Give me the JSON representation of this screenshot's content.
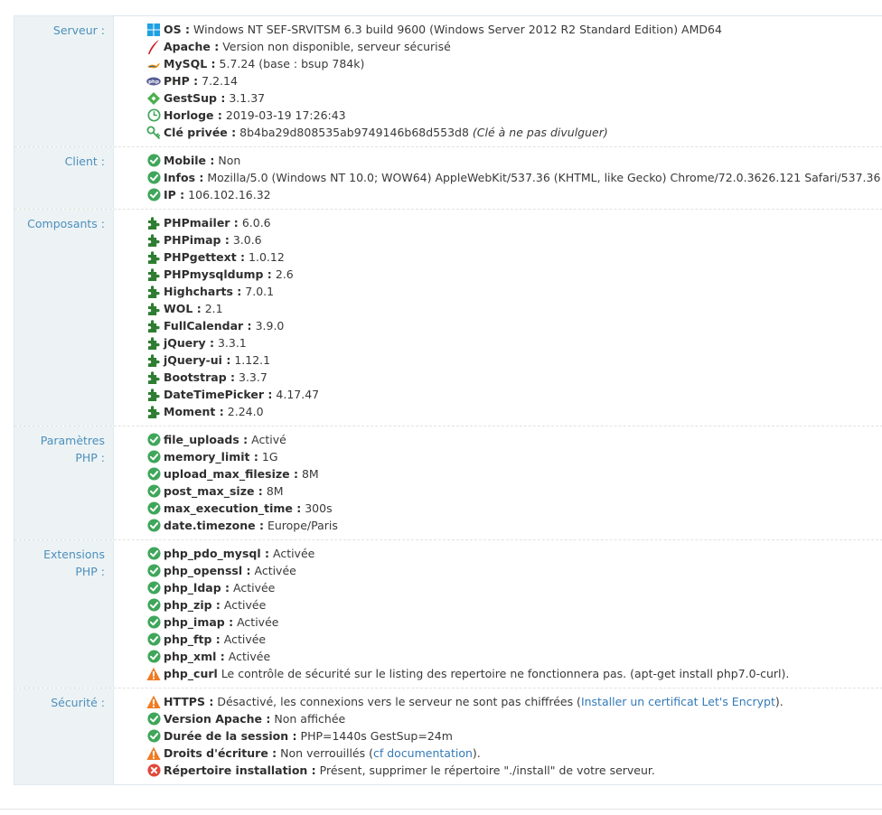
{
  "server": {
    "label": "Serveur :",
    "os_k": "OS :",
    "os_v": "Windows NT SEF-SRVITSM 6.3 build 9600 (Windows Server 2012 R2 Standard Edition) AMD64",
    "apache_k": "Apache :",
    "apache_v": "Version non disponible, serveur sécurisé",
    "mysql_k": "MySQL :",
    "mysql_v": "5.7.24 (base : bsup 784k)",
    "php_k": "PHP :",
    "php_v": "7.2.14",
    "gestsup_k": "GestSup :",
    "gestsup_v": "3.1.37",
    "clock_k": "Horloge :",
    "clock_v": "2019-03-19 17:26:43",
    "key_k": "Clé privée :",
    "key_v": "8b4ba29d808535ab9749146b68d553d8",
    "key_note": "(Clé à ne pas divulguer)"
  },
  "client": {
    "label": "Client :",
    "mobile_k": "Mobile :",
    "mobile_v": "Non",
    "infos_k": "Infos :",
    "infos_v": "Mozilla/5.0 (Windows NT 10.0; WOW64) AppleWebKit/537.36 (KHTML, like Gecko) Chrome/72.0.3626.121 Safari/537.36",
    "ip_k": "IP :",
    "ip_v": "106.102.16.32"
  },
  "components": {
    "label": "Composants :",
    "items": [
      {
        "k": "PHPmailer :",
        "v": "6.0.6"
      },
      {
        "k": "PHPimap :",
        "v": "3.0.6"
      },
      {
        "k": "PHPgettext :",
        "v": "1.0.12"
      },
      {
        "k": "PHPmysqldump :",
        "v": "2.6"
      },
      {
        "k": "Highcharts :",
        "v": "7.0.1"
      },
      {
        "k": "WOL :",
        "v": "2.1"
      },
      {
        "k": "FullCalendar :",
        "v": "3.9.0"
      },
      {
        "k": "jQuery :",
        "v": "3.3.1"
      },
      {
        "k": "jQuery-ui :",
        "v": "1.12.1"
      },
      {
        "k": "Bootstrap :",
        "v": "3.3.7"
      },
      {
        "k": "DateTimePicker :",
        "v": "4.17.47"
      },
      {
        "k": "Moment :",
        "v": "2.24.0"
      }
    ]
  },
  "php_params": {
    "label_1": "Paramètres",
    "label_2": "PHP :",
    "items": [
      {
        "k": "file_uploads :",
        "v": "Activé"
      },
      {
        "k": "memory_limit :",
        "v": "1G"
      },
      {
        "k": "upload_max_filesize :",
        "v": "8M"
      },
      {
        "k": "post_max_size :",
        "v": "8M"
      },
      {
        "k": "max_execution_time :",
        "v": "300s"
      },
      {
        "k": "date.timezone :",
        "v": "Europe/Paris"
      }
    ]
  },
  "php_ext": {
    "label_1": "Extensions",
    "label_2": "PHP :",
    "items": [
      {
        "k": "php_pdo_mysql :",
        "v": "Activée"
      },
      {
        "k": "php_openssl :",
        "v": "Activée"
      },
      {
        "k": "php_ldap :",
        "v": "Activée"
      },
      {
        "k": "php_zip :",
        "v": "Activée"
      },
      {
        "k": "php_imap :",
        "v": "Activée"
      },
      {
        "k": "php_ftp :",
        "v": "Activée"
      },
      {
        "k": "php_xml :",
        "v": "Activée"
      }
    ],
    "curl_k": "php_curl",
    "curl_v": "Le contrôle de sécurité sur le listing des repertoire ne fonctionnera pas. (apt-get install php7.0-curl)."
  },
  "security": {
    "label": "Sécurité :",
    "https_k": "HTTPS :",
    "https_v": "Désactivé, les connexions vers le serveur ne sont pas chiffrées (",
    "https_link": "Installer un certificat Let's Encrypt",
    "https_end": ").",
    "apache_k": "Version Apache :",
    "apache_v": "Non affichée",
    "session_k": "Durée de la session :",
    "session_v": "PHP=1440s GestSup=24m",
    "rights_k": "Droits d'écriture :",
    "rights_v": "Non verrouillés (",
    "rights_link": "cf documentation",
    "rights_end": ").",
    "install_k": "Répertoire installation :",
    "install_v": "Présent, supprimer le répertoire \"./install\" de votre serveur."
  },
  "colors": {
    "ok": "#3fa65a",
    "warn": "#f07b22",
    "error": "#e2493b",
    "label": "#4c8fbd",
    "plugin": "#2e7d32"
  }
}
